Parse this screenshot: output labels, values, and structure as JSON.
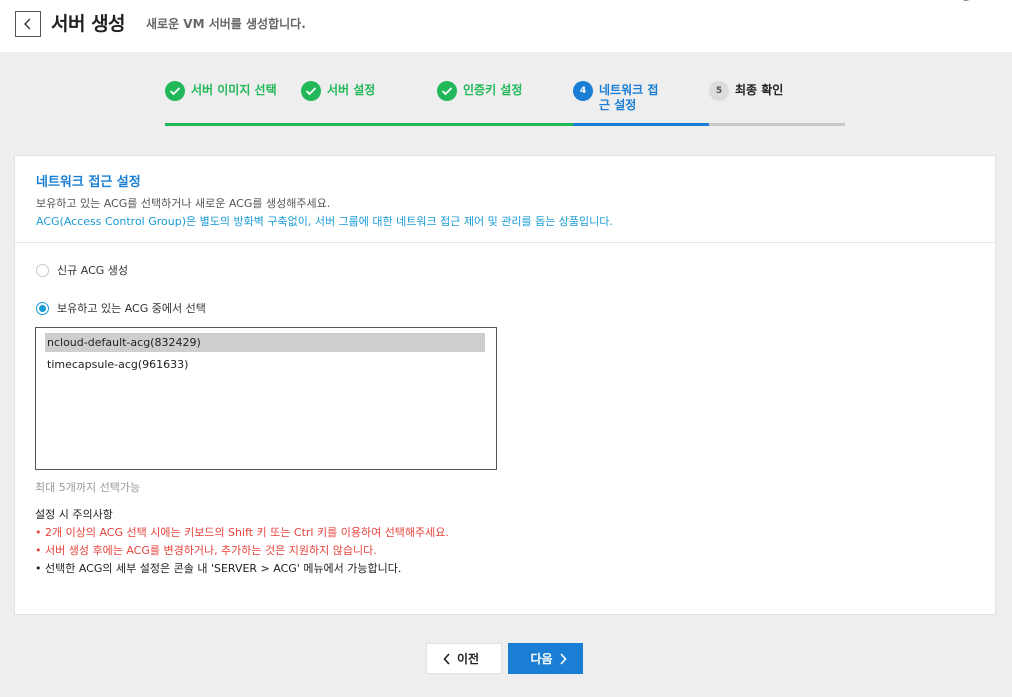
{
  "header": {
    "title": "서버 생성",
    "subtitle": "새로운 VM 서버를 생성합니다."
  },
  "steps": [
    {
      "number": "",
      "label": "서버 이미지 선택",
      "state": "done"
    },
    {
      "number": "",
      "label": "서버 설정",
      "state": "done"
    },
    {
      "number": "",
      "label": "인증키 설정",
      "state": "done"
    },
    {
      "number": "4",
      "label": "네트워크 접근 설정",
      "state": "active"
    },
    {
      "number": "5",
      "label": "최종 확인",
      "state": "todo"
    }
  ],
  "section": {
    "title": "네트워크 접근 설정",
    "description": "보유하고 있는 ACG를 선택하거나 새로운 ACG를 생성해주세요.",
    "note": "ACG(Access Control Group)은 별도의 방화벽 구축없이, 서버 그룹에 대한 네트워크 접근 제어 및 관리를 돕는 상품입니다."
  },
  "options": {
    "new_acg": {
      "label": "신규 ACG 생성",
      "checked": false
    },
    "existing_acg": {
      "label": "보유하고 있는 ACG 중에서 선택",
      "checked": true
    }
  },
  "acg_list": [
    {
      "name": "ncloud-default-acg(832429)",
      "selected": true
    },
    {
      "name": "timecapsule-acg(961633)",
      "selected": false
    }
  ],
  "limit_text": "최대 5개까지 선택가능",
  "notes": {
    "title": "설정 시 주의사항",
    "items": [
      {
        "text": "• 2개 이상의 ACG 선택 시에는 키보드의 Shift 키 또는 Ctrl 키를 이용하여 선택해주세요.",
        "color": "red"
      },
      {
        "text": "• 서버 생성 후에는 ACG를 변경하거나, 추가하는 것은 지원하지 않습니다.",
        "color": "red"
      },
      {
        "text": "• 선택한 ACG의 세부 설정은 콘솔 내 'SERVER > ACG' 메뉴에서 가능합니다.",
        "color": "dark"
      }
    ]
  },
  "buttons": {
    "prev": "이전",
    "next": "다음"
  },
  "colors": {
    "done": "#21b85a",
    "active": "#1a7fd4",
    "warning": "#e8433d"
  }
}
